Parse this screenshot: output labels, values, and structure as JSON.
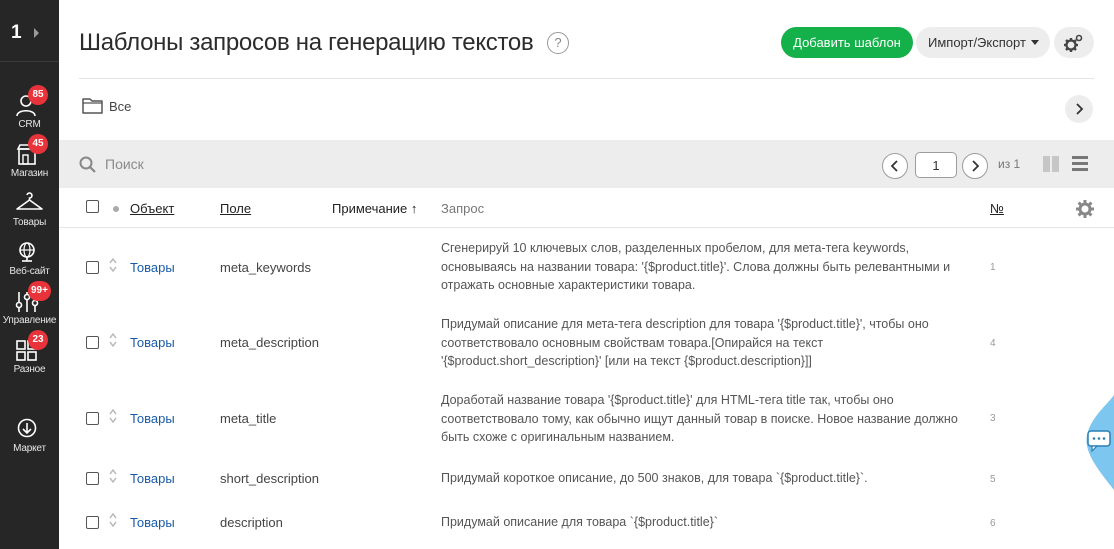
{
  "sidebar": {
    "counter": "1",
    "items": [
      {
        "label": "CRM",
        "icon": "crm-icon",
        "badge": "85"
      },
      {
        "label": "Магазин",
        "icon": "shop-icon",
        "badge": "45"
      },
      {
        "label": "Товары",
        "icon": "hanger-icon",
        "badge": ""
      },
      {
        "label": "Веб-сайт",
        "icon": "globe-icon",
        "badge": ""
      },
      {
        "label": "Управление",
        "icon": "sliders-icon",
        "badge": "99+"
      },
      {
        "label": "Разное",
        "icon": "grid-icon",
        "badge": "23"
      },
      {
        "label": "Маркет",
        "icon": "download-circle-icon",
        "badge": ""
      }
    ]
  },
  "header": {
    "title": "Шаблоны запросов на генерацию текстов",
    "help": "?",
    "add_button": "Добавить шаблон",
    "import_button": "Импорт/Экспорт"
  },
  "folder": {
    "label": "Все"
  },
  "search": {
    "placeholder": "Поиск",
    "value": ""
  },
  "pagination": {
    "current": "1",
    "of_label": "из 1"
  },
  "columns": {
    "object": "Объект",
    "field": "Поле",
    "note": "Примечание ↑",
    "query": "Запрос",
    "number": "№"
  },
  "rows": [
    {
      "object": "Товары",
      "field": "meta_keywords",
      "query": "Сгенерируй 10 ключевых слов, разделенных пробелом, для мета-тега keywords, основываясь на названии товара: '{$product.title}'. Слова должны быть релевантными и отражать основные характеристики товара.",
      "num": "1"
    },
    {
      "object": "Товары",
      "field": "meta_description",
      "query": "Придумай описание для мета-тега description для товара '{$product.title}', чтобы оно соответствовало основным свойствам товара.[Опирайся на текст '{$product.short_description}' [или на текст {$product.description}]]",
      "num": "4"
    },
    {
      "object": "Товары",
      "field": "meta_title",
      "query": "Доработай название товара '{$product.title}' для HTML-тега title так, чтобы оно соответствовало тому, как обычно ищут данный товар в поиске. Новое название должно быть схоже с оригинальным названием.",
      "num": "3"
    },
    {
      "object": "Товары",
      "field": "short_description",
      "query": "Придумай короткое описание, до 500 знаков, для товара `{$product.title}`.",
      "num": "5"
    },
    {
      "object": "Товары",
      "field": "description",
      "query": "Придумай описание для товара `{$product.title}`",
      "num": "6"
    }
  ],
  "colors": {
    "accent_green": "#14b04a",
    "link": "#1a5ba8",
    "badge_red": "#e8333a",
    "sidebar_bg": "#262626"
  }
}
